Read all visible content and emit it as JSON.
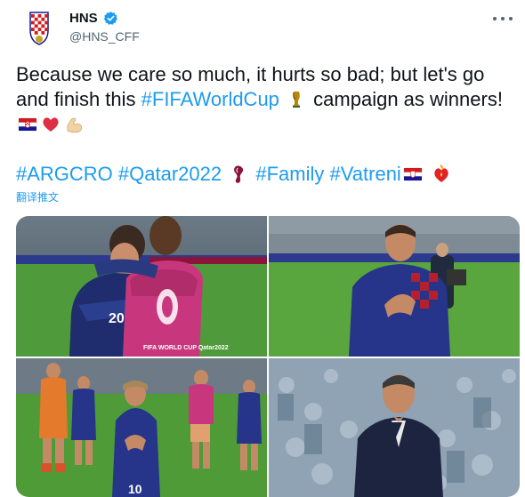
{
  "author": {
    "display_name": "HNS",
    "handle": "@HNS_CFF",
    "avatar_icon": "croatia-football-crest-icon",
    "verified_icon": "verified-badge-icon"
  },
  "tweet": {
    "text_part1": "Because we care so much, it hurts so bad; but let's go and finish this ",
    "hashtag_fifa": "#FIFAWorldCup",
    "text_part2": " campaign as winners! ",
    "emojis_line1": [
      "croatia-flag-icon",
      "red-heart-icon",
      "flexed-biceps-icon"
    ],
    "hashtags": [
      "#ARGCRO",
      "#Qatar2022",
      "#Family",
      "#Vatreni"
    ],
    "translate_label": "翻译推文"
  },
  "media": {
    "photos": [
      {
        "name": "photo-players-embrace",
        "shirt_number": "20",
        "text": "FIFA WORLD CUP Qatar2022"
      },
      {
        "name": "photo-player-applauding"
      },
      {
        "name": "photo-team-applauding-fans",
        "shirt_number": "10"
      },
      {
        "name": "photo-coach-thinking"
      }
    ]
  },
  "colors": {
    "link": "#1d9bf0",
    "text": "#0f1419",
    "muted": "#536471",
    "croatia_red": "#d01c1f",
    "croatia_blue": "#171796"
  }
}
